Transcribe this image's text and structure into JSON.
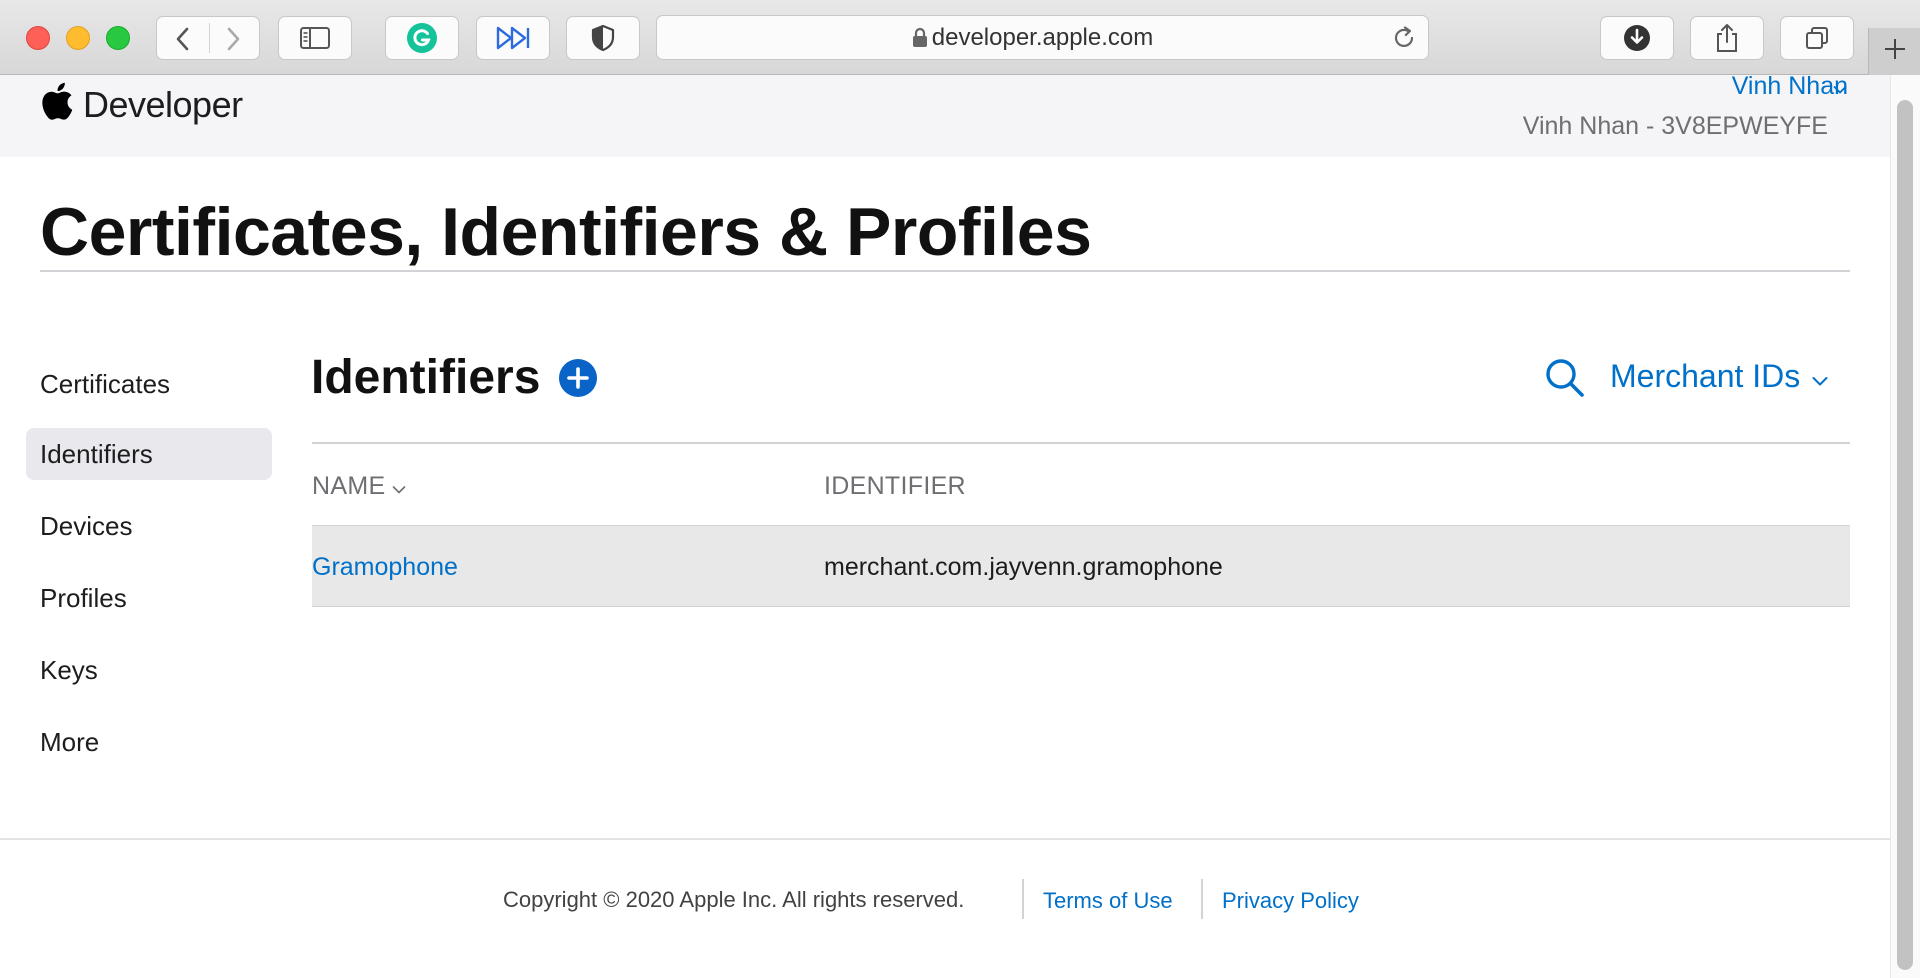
{
  "browser": {
    "url": "developer.apple.com"
  },
  "header": {
    "brand": "Developer",
    "account_name": "Vinh Nhan",
    "team": "Vinh Nhan - 3V8EPWEYFE"
  },
  "page": {
    "title": "Certificates, Identifiers & Profiles"
  },
  "sidebar": {
    "items": [
      {
        "label": "Certificates",
        "active": false
      },
      {
        "label": "Identifiers",
        "active": true
      },
      {
        "label": "Devices",
        "active": false
      },
      {
        "label": "Profiles",
        "active": false
      },
      {
        "label": "Keys",
        "active": false
      },
      {
        "label": "More",
        "active": false
      }
    ]
  },
  "main": {
    "section_title": "Identifiers",
    "filter": "Merchant IDs",
    "columns": [
      "NAME",
      "IDENTIFIER"
    ],
    "rows": [
      {
        "name": "Gramophone",
        "identifier": "merchant.com.jayvenn.gramophone"
      }
    ]
  },
  "footer": {
    "copyright": "Copyright © 2020 Apple Inc. All rights reserved.",
    "links": [
      "Terms of Use",
      "Privacy Policy"
    ]
  },
  "colors": {
    "link": "#0070c9",
    "add_button": "#0a64c8",
    "active_sidebar_bg": "#e8e8ed",
    "selected_row_bg": "#e8e8e8"
  },
  "icons": [
    "back-icon",
    "forward-icon",
    "sidebar-icon",
    "grammarly-icon",
    "fast-forward-icon",
    "shield-icon",
    "lock-icon",
    "reload-icon",
    "download-icon",
    "share-icon",
    "tabs-icon",
    "plus-icon",
    "apple-logo-icon",
    "add-icon",
    "search-icon",
    "chevron-down-icon"
  ]
}
